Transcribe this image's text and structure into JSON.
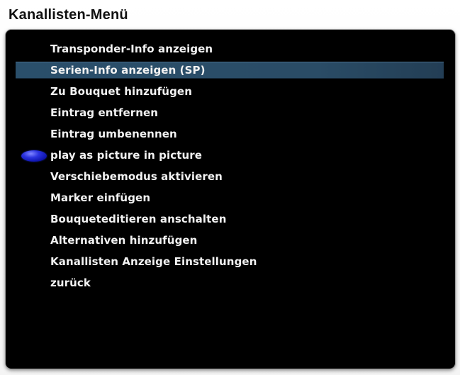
{
  "window": {
    "title": "Kanallisten-Menü"
  },
  "menu": {
    "items": [
      {
        "label": "Transponder-Info anzeigen"
      },
      {
        "label": "Serien-Info anzeigen (SP)"
      },
      {
        "label": "Zu Bouquet hinzufügen"
      },
      {
        "label": "Eintrag entfernen"
      },
      {
        "label": "Eintrag umbenennen"
      },
      {
        "label": "play as picture in picture"
      },
      {
        "label": "Verschiebemodus aktivieren"
      },
      {
        "label": "Marker einfügen"
      },
      {
        "label": "Bouqueteditieren anschalten"
      },
      {
        "label": "Alternativen hinzufügen"
      },
      {
        "label": "Kanallisten Anzeige Einstellungen"
      },
      {
        "label": "zurück"
      }
    ],
    "selected_index": 1,
    "blue_key_index": 5
  },
  "colors": {
    "panel_background": "#000000",
    "text": "#f2f2f2",
    "selection": "#2a4f6b",
    "blue_key": "#2b33e0"
  },
  "icons": {
    "blue_key": "blue-button-icon"
  }
}
